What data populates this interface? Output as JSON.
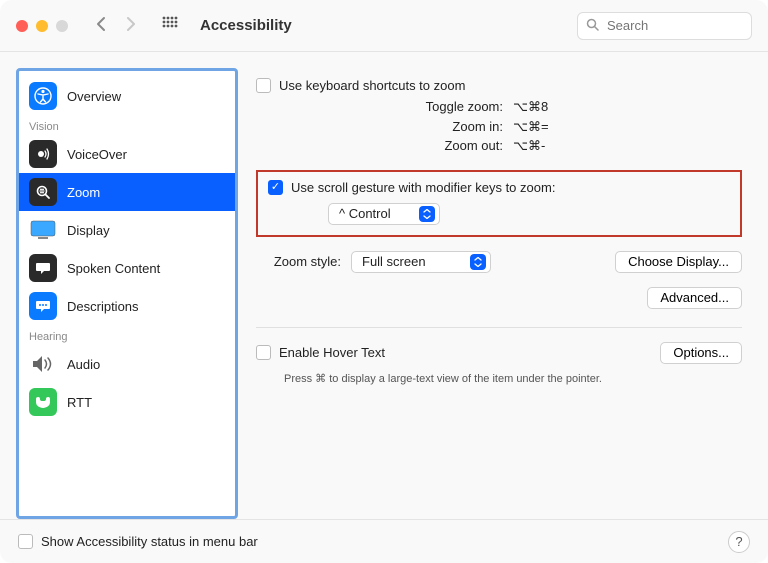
{
  "window": {
    "title": "Accessibility",
    "search_placeholder": "Search"
  },
  "sidebar": {
    "sections": {
      "vision_label": "Vision",
      "hearing_label": "Hearing"
    },
    "items": {
      "overview": "Overview",
      "voiceover": "VoiceOver",
      "zoom": "Zoom",
      "display": "Display",
      "spoken": "Spoken Content",
      "descriptions": "Descriptions",
      "audio": "Audio",
      "rtt": "RTT"
    },
    "selected": "zoom"
  },
  "main": {
    "keyboard_shortcuts": {
      "checked": false,
      "label": "Use keyboard shortcuts to zoom",
      "toggle_label": "Toggle zoom:",
      "toggle_keys": "⌥⌘8",
      "zoomin_label": "Zoom in:",
      "zoomin_keys": "⌥⌘=",
      "zoomout_label": "Zoom out:",
      "zoomout_keys": "⌥⌘-"
    },
    "scroll_gesture": {
      "checked": true,
      "label": "Use scroll gesture with modifier keys to zoom:",
      "modifier_value": "^ Control"
    },
    "zoom_style": {
      "label": "Zoom style:",
      "value": "Full screen",
      "choose_display_button": "Choose Display..."
    },
    "advanced_button": "Advanced...",
    "hover_text": {
      "checked": false,
      "label": "Enable Hover Text",
      "options_button": "Options...",
      "description": "Press ⌘ to display a large-text view of the item under the pointer."
    }
  },
  "footer": {
    "show_status_label": "Show Accessibility status in menu bar",
    "show_status_checked": false,
    "help": "?"
  }
}
